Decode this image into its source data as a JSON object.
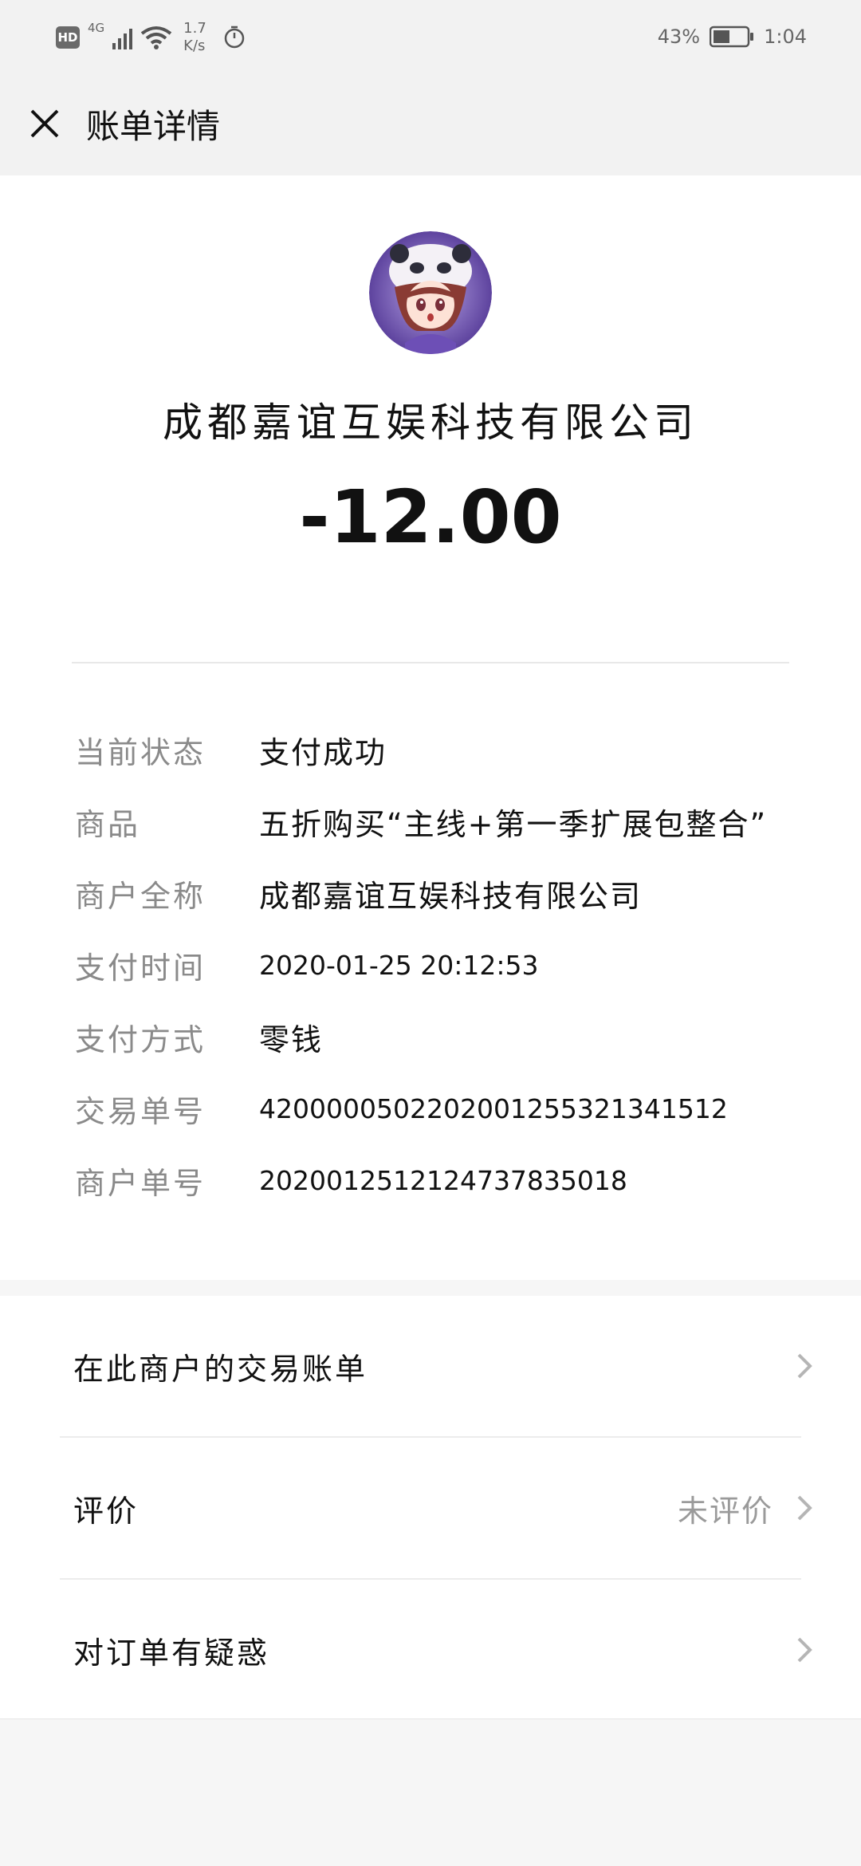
{
  "status_bar": {
    "hd": "HD",
    "network": "4G",
    "speed_value": "1.7",
    "speed_unit": "K/s",
    "battery_percent": "43%",
    "time": "1:04"
  },
  "header": {
    "title": "账单详情"
  },
  "merchant": {
    "name": "成都嘉谊互娱科技有限公司",
    "amount": "-12.00"
  },
  "details": [
    {
      "label": "当前状态",
      "value": "支付成功"
    },
    {
      "label": "商品",
      "value": "五折购买“主线+第一季扩展包整合”"
    },
    {
      "label": "商户全称",
      "value": "成都嘉谊互娱科技有限公司"
    },
    {
      "label": "支付时间",
      "value": "2020-01-25 20:12:53"
    },
    {
      "label": "支付方式",
      "value": "零钱"
    },
    {
      "label": "交易单号",
      "value": "4200000502202001255321341512"
    },
    {
      "label": "商户单号",
      "value": "202001251212473783501​8"
    }
  ],
  "actions": [
    {
      "label": "在此商户的交易账单",
      "value": ""
    },
    {
      "label": "评价",
      "value": "未评价"
    },
    {
      "label": "对订单有疑惑",
      "value": ""
    }
  ],
  "icons": {
    "close": "close-icon",
    "chevron": "chevron-right-icon",
    "wifi": "wifi-icon",
    "battery": "battery-icon",
    "timer": "timer-icon"
  }
}
